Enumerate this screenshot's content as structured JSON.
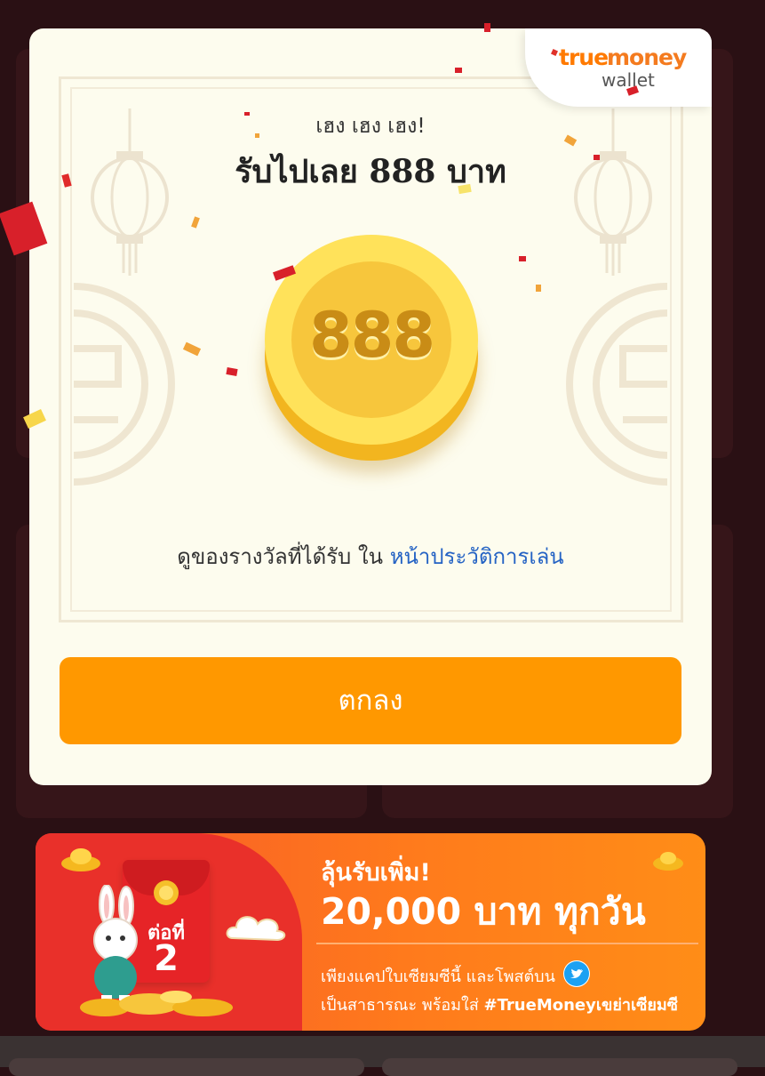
{
  "modal": {
    "brand": {
      "word1": "true",
      "word2": "money",
      "word3": "wallet"
    },
    "subtitle": "เฮง เฮง เฮง!",
    "title": "รับไปเลย 888 บาท",
    "coin_value": "888",
    "history_text": "ดูของรางวัลที่ได้รับ ใน ",
    "history_link": "หน้าประวัติการเล่น",
    "ok_button": "ตกลง"
  },
  "banner": {
    "headline1": "ลุ้นรับเพิ่ม!",
    "headline2": "20,000 บาท ทุกวัน",
    "line1": "เพียงแคปใบเซียมซีนี้ และโพสต์บน",
    "line2_text": "เป็นสาธารณะ พร้อมใส่ ",
    "line2_tag": "#TrueMoneyเขย่าเซียมซี",
    "envelope_label": "ต่อที่",
    "envelope_number": "2"
  },
  "colors": {
    "accent": "#ff9800",
    "link": "#2563c4",
    "modal_bg": "#fdfcee",
    "backdrop": "#2a1014",
    "banner_red": "#e9302a",
    "banner_orange": "#ff8d17"
  },
  "icons": [
    "lantern-icon",
    "coin-icon",
    "twitter-icon",
    "rabbit-icon",
    "gold-ingot-icon",
    "cloud-icon"
  ]
}
